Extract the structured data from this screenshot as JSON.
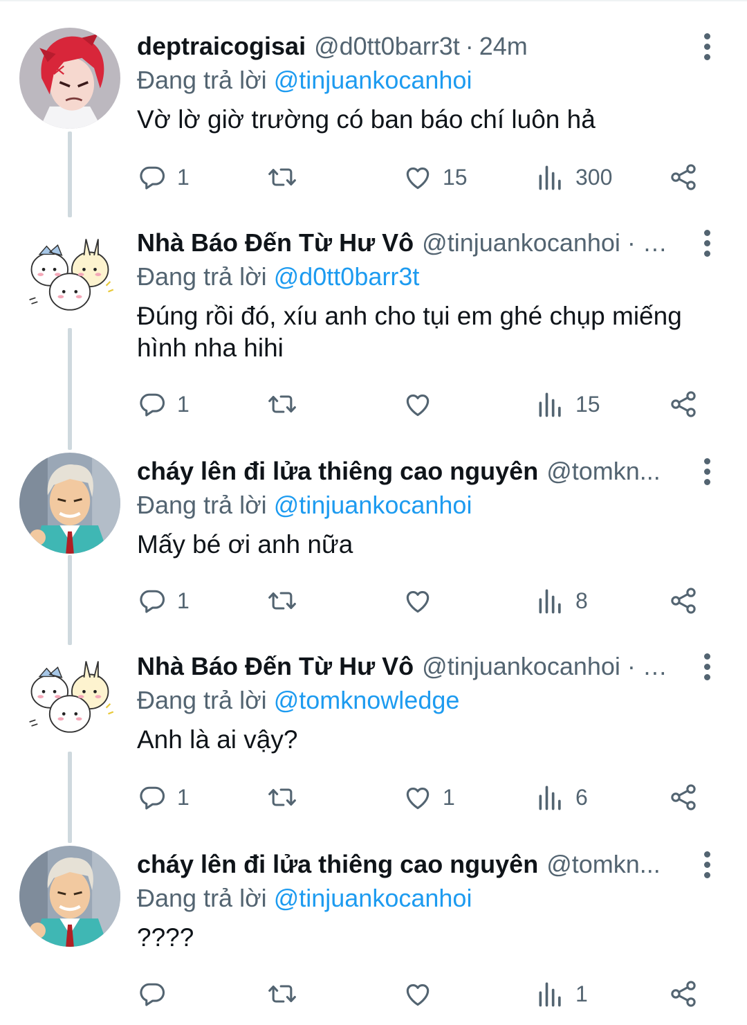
{
  "replying_label": "Đang trả lời",
  "colors": {
    "accent": "#1d9bf0",
    "secondary_text": "#536471",
    "primary_text": "#0f1419"
  },
  "tweets": [
    {
      "name": "deptraicogisai",
      "handle": "@d0tt0barr3t",
      "time": "24m",
      "replying_to": "@tinjuankocanhoi",
      "text": "Vờ lờ giờ trường có ban báo chí luôn hả",
      "replies": "1",
      "retweets": "",
      "likes": "15",
      "views": "300",
      "avatar": "red-haired anime boy"
    },
    {
      "name": "Nhà Báo Đến Từ Hư Vô",
      "handle": "@tinjuankocanhoi · …",
      "time": "",
      "replying_to": "@d0tt0barr3t",
      "text": "Đúng rồi đó, xíu anh cho tụi em ghé chụp miếng hình nha hihi",
      "replies": "1",
      "retweets": "",
      "likes": "",
      "views": "15",
      "avatar": "chiikawa characters"
    },
    {
      "name": "cháy lên đi lửa thiêng cao nguyên",
      "handle": "@tomkn...",
      "time": "",
      "replying_to": "@tinjuankocanhoi",
      "text": "Mấy bé ơi anh nữa",
      "replies": "1",
      "retweets": "",
      "likes": "",
      "views": "8",
      "avatar": "grey-haired anime man in teal blazer"
    },
    {
      "name": "Nhà Báo Đến Từ Hư Vô",
      "handle": "@tinjuankocanhoi · …",
      "time": "",
      "replying_to": "@tomknowledge",
      "text": "Anh là ai vậy?",
      "replies": "1",
      "retweets": "",
      "likes": "1",
      "views": "6",
      "avatar": "chiikawa characters"
    },
    {
      "name": "cháy lên đi lửa thiêng cao nguyên",
      "handle": "@tomkn...",
      "time": "",
      "replying_to": "@tinjuankocanhoi",
      "text": "????",
      "replies": "",
      "retweets": "",
      "likes": "",
      "views": "1",
      "avatar": "grey-haired anime man in teal blazer"
    }
  ],
  "icons": {
    "reply": "reply-icon",
    "retweet": "retweet-icon",
    "like": "heart-icon",
    "views": "views-icon",
    "share": "share-icon",
    "more": "more-icon"
  }
}
